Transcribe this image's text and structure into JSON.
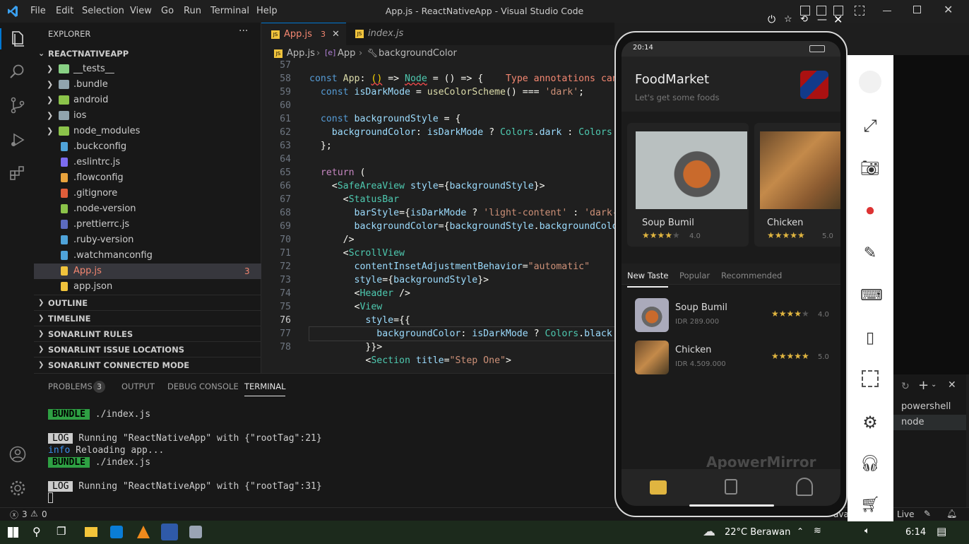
{
  "window": {
    "title": "App.js - ReactNativeApp - Visual Studio Code",
    "menus": [
      "File",
      "Edit",
      "Selection",
      "View",
      "Go",
      "Run",
      "Terminal",
      "Help"
    ]
  },
  "explorer": {
    "header": "EXPLORER",
    "root": "REACTNATIVEAPP",
    "items": [
      {
        "name": "__tests__",
        "type": "folder",
        "color": "#89d185"
      },
      {
        "name": ".bundle",
        "type": "folder",
        "color": "#90a4ae"
      },
      {
        "name": "android",
        "type": "folder",
        "color": "#8bc34a"
      },
      {
        "name": "ios",
        "type": "folder",
        "color": "#90a4ae"
      },
      {
        "name": "node_modules",
        "type": "folder",
        "color": "#8bc34a"
      },
      {
        "name": ".buckconfig",
        "type": "file",
        "color": "#4fa3d9"
      },
      {
        "name": ".eslintrc.js",
        "type": "file",
        "color": "#7c6cf0"
      },
      {
        "name": ".flowconfig",
        "type": "file",
        "color": "#e8a33d"
      },
      {
        "name": ".gitignore",
        "type": "file",
        "color": "#e05d3a"
      },
      {
        "name": ".node-version",
        "type": "file",
        "color": "#8bc34a"
      },
      {
        "name": ".prettierrc.js",
        "type": "file",
        "color": "#5c6bc0"
      },
      {
        "name": ".ruby-version",
        "type": "file",
        "color": "#4fa3d9"
      },
      {
        "name": ".watchmanconfig",
        "type": "file",
        "color": "#4fa3d9"
      },
      {
        "name": "App.js",
        "type": "file",
        "color": "#f0c33c",
        "badge": "3"
      },
      {
        "name": "app.json",
        "type": "file",
        "color": "#f0c33c"
      }
    ],
    "sections": [
      "OUTLINE",
      "TIMELINE",
      "SONARLINT RULES",
      "SONARLINT ISSUE LOCATIONS",
      "SONARLINT CONNECTED MODE"
    ]
  },
  "tabs": [
    {
      "label": "App.js",
      "badge": "3"
    },
    {
      "label": "index.js"
    }
  ],
  "breadcrumb": [
    "App.js",
    "App",
    "backgroundColor"
  ],
  "editor": {
    "lines": [
      "57",
      "58",
      "59",
      "60",
      "61",
      "62",
      "63",
      "64",
      "65",
      "66",
      "67",
      "68",
      "69",
      "70",
      "71",
      "72",
      "73",
      "74",
      "75",
      "76",
      "77",
      "78"
    ],
    "current": "76"
  },
  "panel": {
    "tabs": [
      "PROBLEMS",
      "OUTPUT",
      "DEBUG CONSOLE",
      "TERMINAL"
    ],
    "problems_count": "3",
    "terminal": {
      "bundle": "BUNDLE",
      "log": "LOG",
      "line1": " ./index.js",
      "line2": " Running \"ReactNativeApp\" with {\"rootTag\":21}",
      "info": "info",
      "line3": " Reloading app...",
      "line4": " ./index.js",
      "line5": " Running \"ReactNativeApp\" with {\"rootTag\":31}"
    },
    "shells": [
      "powershell",
      "node"
    ]
  },
  "statusbar": {
    "errors": "3",
    "warnings": "0",
    "live": "Live",
    "lang": "avaSc"
  },
  "taskbar": {
    "weather": "22°C  Berawan",
    "time": "6:14"
  },
  "phone": {
    "status_time": "20:14",
    "app_title": "FoodMarket",
    "app_subtitle": "Let's get some foods",
    "cards": [
      {
        "name": "Soup Bumil",
        "stars": 4,
        "rating": "4.0"
      },
      {
        "name": "Chicken",
        "stars": 5,
        "rating": "5.0"
      }
    ],
    "tabs": [
      "New Taste",
      "Popular",
      "Recommended"
    ],
    "list": [
      {
        "name": "Soup Bumil",
        "price": "IDR 289.000",
        "stars": 4,
        "rating": "4.0"
      },
      {
        "name": "Chicken",
        "price": "IDR 4.509.000",
        "stars": 5,
        "rating": "5.0"
      }
    ],
    "watermark": "ApowerMirror"
  }
}
